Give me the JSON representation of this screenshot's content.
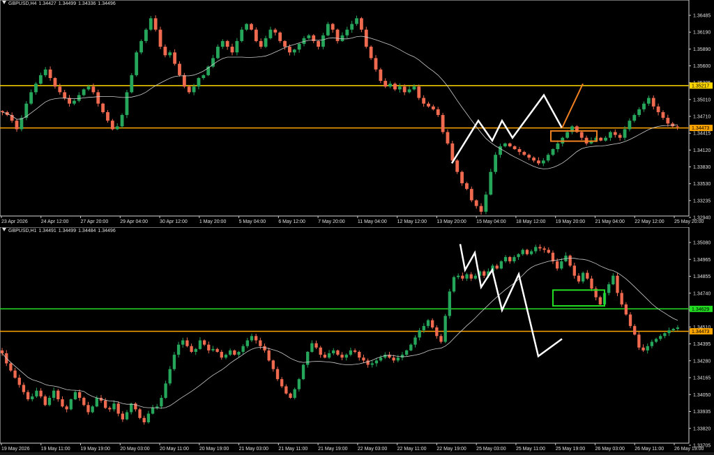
{
  "top_chart": {
    "header": {
      "symbol": "GBPUSD,H4",
      "ohlc": [
        "1.34427",
        "1.34499",
        "1.34336",
        "1.34496"
      ]
    },
    "price_axis": [
      "1.36485",
      "1.36190",
      "1.35890",
      "1.35600",
      "1.35305",
      "1.35010",
      "1.34710",
      "1.34415",
      "1.34120",
      "1.33830",
      "1.33530",
      "1.33235",
      "1.32940"
    ],
    "time_axis": [
      "23 Apr 2026",
      "24 Apr 12:00",
      "27 Apr 20:00",
      "29 Apr 04:00",
      "30 Apr 12:00",
      "1 May 20:00",
      "5 May 04:00",
      "6 May 12:00",
      "7 May 20:00",
      "11 May 04:00",
      "12 May 12:00",
      "13 May 20:00",
      "15 May 04:00",
      "18 May 12:00",
      "19 May 20:00",
      "21 May 04:00",
      "22 May 12:00",
      "25 May 20:00"
    ],
    "levels": [
      {
        "label": "1.35217",
        "color": "#ffd700"
      },
      {
        "label": "1.34473",
        "color": "#ffa500"
      }
    ]
  },
  "bottom_chart": {
    "header": {
      "symbol": "GBPUSD,H1",
      "ohlc": [
        "1.34491",
        "1.34499",
        "1.34484",
        "1.34496"
      ]
    },
    "price_axis": [
      "1.35080",
      "1.34965",
      "1.34855",
      "1.34740",
      "1.34625",
      "1.34510",
      "1.34395",
      "1.34280",
      "1.34165",
      "1.34050",
      "1.33935",
      "1.33820",
      "1.33705"
    ],
    "time_axis": [
      "19 May 2026",
      "19 May 11:00",
      "19 May 19:00",
      "20 May 03:00",
      "20 May 11:00",
      "20 May 19:00",
      "21 May 03:00",
      "21 May 11:00",
      "21 May 19:00",
      "22 May 03:00",
      "22 May 11:00",
      "22 May 19:00",
      "25 May 03:00",
      "25 May 11:00",
      "25 May 19:00",
      "26 May 03:00",
      "26 May 11:00",
      "26 May 19:00"
    ],
    "levels": [
      {
        "label": "1.34629",
        "color": "#22dd22"
      },
      {
        "label": "1.34473",
        "color": "#ffa500"
      }
    ]
  },
  "chart_data": [
    {
      "type": "candlestick",
      "symbol": "GBPUSD",
      "timeframe": "H4",
      "ylim": [
        1.329,
        1.3655
      ],
      "grid": false,
      "up_color": "#26a65b",
      "down_color": "#f06a50",
      "ma_color": "#cccccc",
      "horizontal_lines": [
        1.35217,
        1.34473
      ],
      "close_path": [
        1.3475,
        1.347,
        1.346,
        1.3445,
        1.3465,
        1.349,
        1.351,
        1.3525,
        1.354,
        1.355,
        1.3535,
        1.352,
        1.351,
        1.35,
        1.349,
        1.3495,
        1.3505,
        1.3515,
        1.352,
        1.351,
        1.349,
        1.3475,
        1.346,
        1.3445,
        1.345,
        1.347,
        1.351,
        1.354,
        1.358,
        1.36,
        1.362,
        1.364,
        1.362,
        1.359,
        1.3575,
        1.358,
        1.356,
        1.354,
        1.352,
        1.351,
        1.352,
        1.3535,
        1.354,
        1.3555,
        1.357,
        1.359,
        1.36,
        1.359,
        1.358,
        1.36,
        1.362,
        1.363,
        1.362,
        1.36,
        1.359,
        1.3605,
        1.362,
        1.3615,
        1.36,
        1.359,
        1.358,
        1.3585,
        1.3595,
        1.3605,
        1.361,
        1.36,
        1.359,
        1.361,
        1.363,
        1.362,
        1.36,
        1.361,
        1.362,
        1.363,
        1.364,
        1.362,
        1.359,
        1.357,
        1.355,
        1.353,
        1.352,
        1.3525,
        1.3515,
        1.352,
        1.351,
        1.3515,
        1.352,
        1.35,
        1.349,
        1.3485,
        1.348,
        1.347,
        1.344,
        1.342,
        1.339,
        1.337,
        1.335,
        1.334,
        1.332,
        1.331,
        1.33,
        1.333,
        1.337,
        1.34,
        1.3415,
        1.342,
        1.3415,
        1.341,
        1.3405,
        1.34,
        1.3395,
        1.339,
        1.3385,
        1.339,
        1.34,
        1.341,
        1.342,
        1.343,
        1.344,
        1.345,
        1.344,
        1.343,
        1.342,
        1.3425,
        1.343,
        1.3425,
        1.343,
        1.344,
        1.3435,
        1.343,
        1.3445,
        1.346,
        1.347,
        1.348,
        1.349,
        1.35,
        1.3485,
        1.3475,
        1.3465,
        1.3455,
        1.345,
        1.3449
      ],
      "zigzag": [
        1.3385,
        1.346,
        1.3425,
        1.346,
        1.343,
        1.3505,
        1.3447,
        1.347
      ],
      "projection_arrow": {
        "from": 1.3447,
        "to": 1.3525
      },
      "target_box": {
        "y_top": 1.3442,
        "y_bottom": 1.3424
      }
    },
    {
      "type": "candlestick",
      "symbol": "GBPUSD",
      "timeframe": "H1",
      "ylim": [
        1.3368,
        1.3513
      ],
      "grid": false,
      "up_color": "#26a65b",
      "down_color": "#f06a50",
      "ma_color": "#cccccc",
      "horizontal_lines": [
        1.34629,
        1.34473
      ],
      "close_path": [
        1.3432,
        1.3425,
        1.342,
        1.3415,
        1.341,
        1.3405,
        1.34,
        1.3402,
        1.3406,
        1.3402,
        1.3396,
        1.3401,
        1.3406,
        1.34,
        1.3395,
        1.3393,
        1.34,
        1.3405,
        1.3401,
        1.3396,
        1.3391,
        1.3395,
        1.3401,
        1.3399,
        1.3394,
        1.3393,
        1.3397,
        1.339,
        1.3386,
        1.3391,
        1.3397,
        1.3393,
        1.3387,
        1.3384,
        1.339,
        1.3394,
        1.3395,
        1.3401,
        1.3411,
        1.3421,
        1.3431,
        1.3438,
        1.3441,
        1.3437,
        1.3433,
        1.3435,
        1.3441,
        1.3438,
        1.3434,
        1.3435,
        1.3433,
        1.3429,
        1.3431,
        1.3434,
        1.3431,
        1.3433,
        1.3437,
        1.3441,
        1.3444,
        1.3441,
        1.3437,
        1.3434,
        1.3427,
        1.3421,
        1.3414,
        1.3409,
        1.3404,
        1.3401,
        1.3407,
        1.3414,
        1.3424,
        1.3433,
        1.3439,
        1.3436,
        1.3431,
        1.3429,
        1.3432,
        1.3434,
        1.3431,
        1.3429,
        1.3431,
        1.3434,
        1.3433,
        1.3429,
        1.3427,
        1.3424,
        1.3425,
        1.3427,
        1.3429,
        1.3431,
        1.3429,
        1.3427,
        1.3429,
        1.3431,
        1.3434,
        1.3438,
        1.3443,
        1.3448,
        1.3451,
        1.3455,
        1.345,
        1.3444,
        1.344,
        1.3458,
        1.3475,
        1.3485,
        1.3486,
        1.3484,
        1.3487,
        1.3484,
        1.3486,
        1.3489,
        1.3486,
        1.3489,
        1.3493,
        1.3491,
        1.3496,
        1.3499,
        1.3496,
        1.3499,
        1.3501,
        1.3504,
        1.3501,
        1.3503,
        1.3506,
        1.3505,
        1.3504,
        1.3502,
        1.3496,
        1.3491,
        1.3496,
        1.35,
        1.3493,
        1.3486,
        1.3482,
        1.3488,
        1.3484,
        1.3477,
        1.3471,
        1.3466,
        1.3474,
        1.348,
        1.3486,
        1.3474,
        1.3466,
        1.3459,
        1.3451,
        1.3445,
        1.3436,
        1.3434,
        1.3437,
        1.344,
        1.3442,
        1.3444,
        1.3446,
        1.3448,
        1.3449,
        1.345
      ],
      "zigzag": [
        1.3508,
        1.349,
        1.3502,
        1.3478,
        1.349,
        1.3462,
        1.3487,
        1.343,
        1.3442
      ],
      "target_box": {
        "y_top": 1.3476,
        "y_bottom": 1.3465
      }
    }
  ]
}
